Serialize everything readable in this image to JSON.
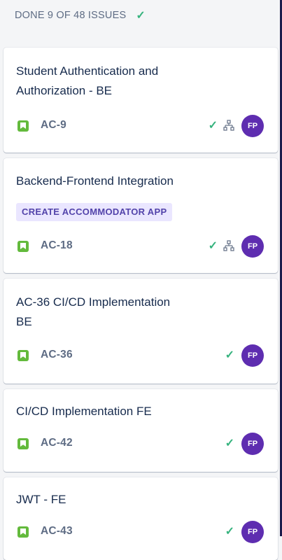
{
  "column": {
    "header": "DONE 9 OF 48 ISSUES",
    "header_icon": "check-icon"
  },
  "cards": [
    {
      "title_lines": [
        "Student Authentication and",
        "Authorization - BE"
      ],
      "key": "AC-9",
      "issue_type": "story",
      "done": true,
      "has_subtasks": true,
      "assignee": "FP"
    },
    {
      "title_lines": [
        "Backend-Frontend Integration"
      ],
      "epic": "CREATE ACCOMMODATOR APP",
      "key": "AC-18",
      "issue_type": "story",
      "done": true,
      "has_subtasks": true,
      "assignee": "FP"
    },
    {
      "title_lines": [
        "AC-36 CI/CD Implementation",
        "BE"
      ],
      "key": "AC-36",
      "issue_type": "story",
      "done": true,
      "has_subtasks": false,
      "assignee": "FP"
    },
    {
      "title_lines": [
        "CI/CD Implementation FE"
      ],
      "key": "AC-42",
      "issue_type": "story",
      "done": true,
      "has_subtasks": false,
      "assignee": "FP"
    },
    {
      "title_lines": [
        "JWT - FE"
      ],
      "key": "AC-43",
      "issue_type": "story",
      "done": true,
      "has_subtasks": false,
      "assignee": "FP"
    }
  ],
  "colors": {
    "story": "#63ba3c",
    "done_check": "#36b37e",
    "avatar": "#5e2db0",
    "epic_bg": "#eae6ff",
    "epic_text": "#5243aa"
  }
}
